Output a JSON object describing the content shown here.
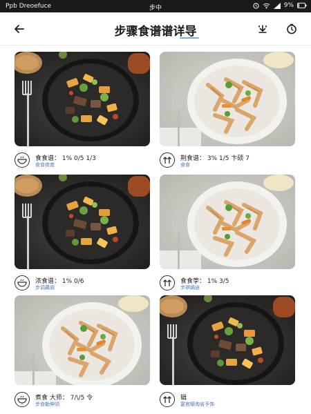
{
  "status_bar": {
    "app_name": "Ppb Dreoefuce",
    "center_text": "步中",
    "battery": "9%"
  },
  "header": {
    "title": "步骤食谱谱详导",
    "back_icon": "arrow-left-icon",
    "download_icon": "download-icon",
    "timer_icon": "timer-icon"
  },
  "recipes": [
    {
      "line1": "食食谱： 1%  0/5  1/3",
      "line2": "食食夜度",
      "icon": "bowl-icon"
    },
    {
      "line1": "荆食谱： 3%  1/5  卞硕  7",
      "line2": "食食",
      "icon": "up-arrows-icon"
    },
    {
      "line1": "浓食谱： 1%  0/6",
      "line2": "步调藕逾",
      "icon": "bowl-icon"
    },
    {
      "line1": "食食荸： 1%  3/5",
      "line2": "步祺嫡途",
      "icon": "up-arrows-icon"
    },
    {
      "line1": "煮食 大师： 7/\\/5  令",
      "line2": "步食勒伸领",
      "icon": "bowl-icon"
    },
    {
      "line1": "辑",
      "line2": "宴官聊淘省予饰",
      "icon": "up-arrows-icon"
    }
  ]
}
